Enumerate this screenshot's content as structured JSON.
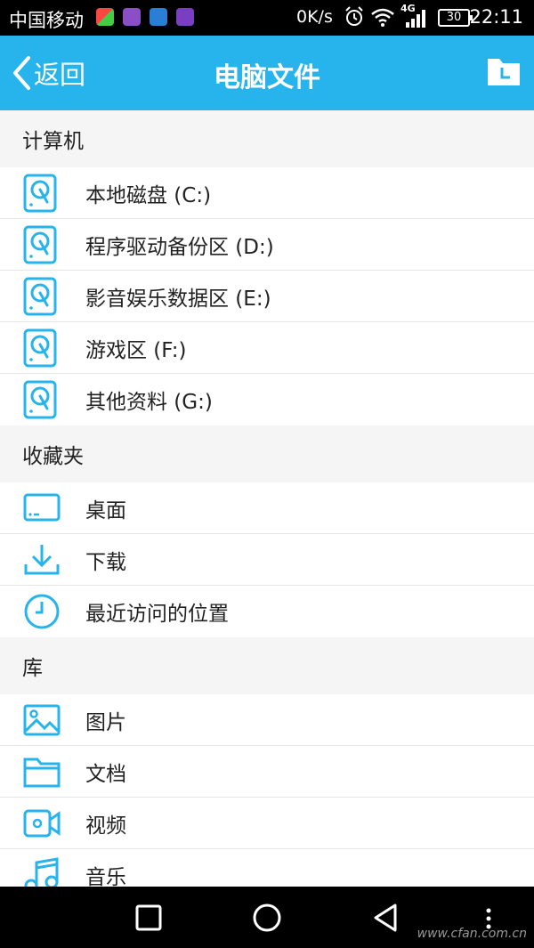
{
  "status_bar": {
    "carrier": "中国移动",
    "speed": "0K/s",
    "network_type": "4G",
    "battery": "30",
    "time": "22:11"
  },
  "title_bar": {
    "back_label": "返回",
    "title": "电脑文件",
    "accent": "#27b4ec"
  },
  "sections": {
    "computer": {
      "header": "计算机",
      "items": [
        {
          "label": "本地磁盘 (C:)",
          "icon": "drive-icon"
        },
        {
          "label": "程序驱动备份区 (D:)",
          "icon": "drive-icon"
        },
        {
          "label": "影音娱乐数据区 (E:)",
          "icon": "drive-icon"
        },
        {
          "label": "游戏区 (F:)",
          "icon": "drive-icon"
        },
        {
          "label": "其他资料 (G:)",
          "icon": "drive-icon"
        }
      ]
    },
    "favorites": {
      "header": "收藏夹",
      "items": [
        {
          "label": "桌面",
          "icon": "desktop-icon"
        },
        {
          "label": "下载",
          "icon": "download-icon"
        },
        {
          "label": "最近访问的位置",
          "icon": "clock-icon"
        }
      ]
    },
    "library": {
      "header": "库",
      "items": [
        {
          "label": "图片",
          "icon": "image-icon"
        },
        {
          "label": "文档",
          "icon": "folder-icon"
        },
        {
          "label": "视频",
          "icon": "video-icon"
        },
        {
          "label": "音乐",
          "icon": "music-icon"
        }
      ]
    }
  },
  "watermark": "www.cfan.com.cn"
}
